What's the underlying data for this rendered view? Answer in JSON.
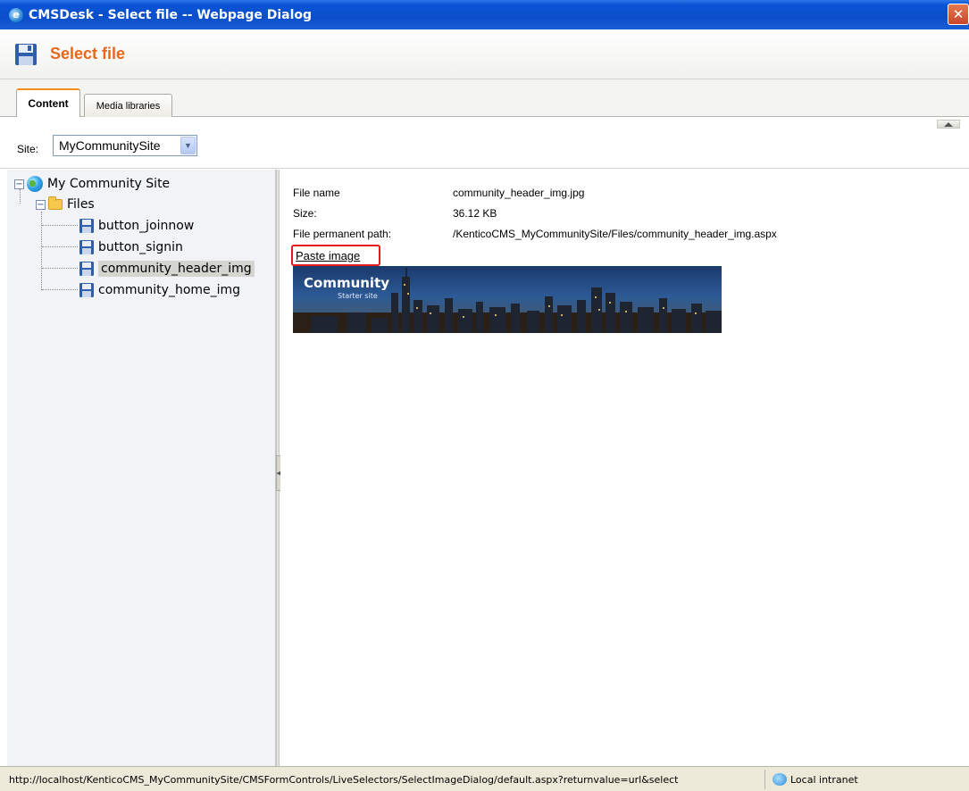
{
  "window": {
    "title": "CMSDesk - Select file -- Webpage Dialog",
    "close_glyph": "✕"
  },
  "header": {
    "title": "Select file",
    "icon": "floppy-disk-icon"
  },
  "tabs": [
    {
      "label": "Content",
      "active": true
    },
    {
      "label": "Media libraries",
      "active": false
    }
  ],
  "site": {
    "label": "Site:",
    "selected": "MyCommunitySite"
  },
  "tree": {
    "root": "My Community Site",
    "folder": "Files",
    "files": [
      "button_joinnow",
      "button_signin",
      "community_header_img",
      "community_home_img"
    ],
    "selected": "community_header_img"
  },
  "file_details": {
    "name_label": "File name",
    "name_value": "community_header_img.jpg",
    "size_label": "Size:",
    "size_value": "36.12 KB",
    "path_label": "File permanent path:",
    "path_value": "/KenticoCMS_MyCommunitySite/Files/community_header_img.aspx",
    "paste_link": "Paste image"
  },
  "preview": {
    "brand": "Community",
    "subtitle": "Starter site"
  },
  "statusbar": {
    "url": "http://localhost/KenticoCMS_MyCommunitySite/CMSFormControls/LiveSelectors/SelectImageDialog/default.aspx?returnvalue=url&select",
    "zone": "Local intranet"
  },
  "colors": {
    "accent": "#e9661c",
    "highlight_box": "#e21a1a",
    "titlebar": "#0a4ec9"
  }
}
